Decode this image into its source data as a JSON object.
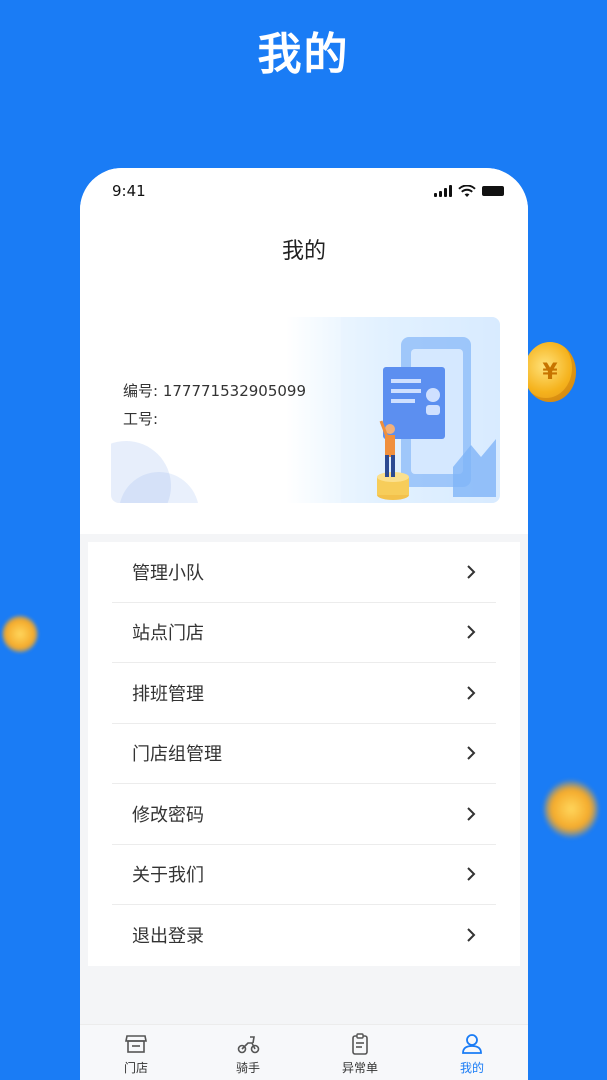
{
  "promo": {
    "title": "我的"
  },
  "status_bar": {
    "time": "9:41"
  },
  "header": {
    "title": "我的"
  },
  "profile_card": {
    "number_label": "编号:",
    "number_value": "17777153290509 9",
    "employee_label": "工号:",
    "employee_value": ""
  },
  "menu": {
    "items": [
      {
        "label": "管理小队",
        "icon": "chevron-right-icon"
      },
      {
        "label": "站点门店",
        "icon": "chevron-right-icon"
      },
      {
        "label": "排班管理",
        "icon": "chevron-right-icon"
      },
      {
        "label": "门店组管理",
        "icon": "chevron-right-icon"
      },
      {
        "label": "修改密码",
        "icon": "chevron-right-icon"
      },
      {
        "label": "关于我们",
        "icon": "chevron-right-icon"
      },
      {
        "label": "退出登录",
        "icon": "chevron-right-icon"
      }
    ]
  },
  "tabbar": {
    "tabs": [
      {
        "label": "门店",
        "icon": "store-icon",
        "active": false
      },
      {
        "label": "骑手",
        "icon": "scooter-icon",
        "active": false
      },
      {
        "label": "异常单",
        "icon": "clipboard-icon",
        "active": false
      },
      {
        "label": "我的",
        "icon": "user-icon",
        "active": true
      }
    ]
  },
  "colors": {
    "accent": "#1a7cf5",
    "background": "#f4f5f7",
    "text": "#333333"
  }
}
